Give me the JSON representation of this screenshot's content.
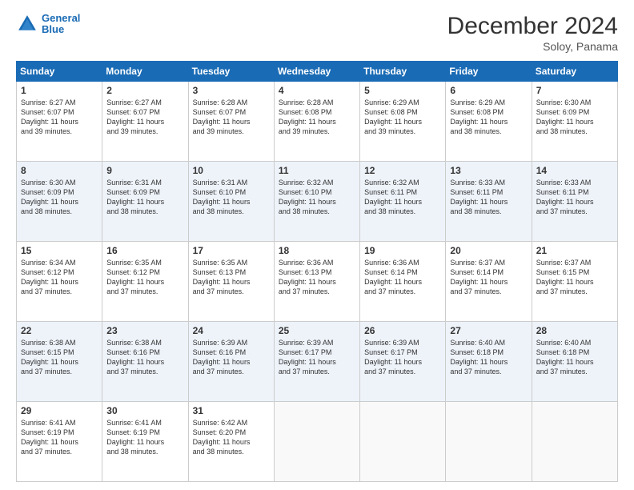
{
  "header": {
    "logo_line1": "General",
    "logo_line2": "Blue",
    "month_title": "December 2024",
    "location": "Soloy, Panama"
  },
  "weekdays": [
    "Sunday",
    "Monday",
    "Tuesday",
    "Wednesday",
    "Thursday",
    "Friday",
    "Saturday"
  ],
  "weeks": [
    [
      {
        "day": "1",
        "info": "Sunrise: 6:27 AM\nSunset: 6:07 PM\nDaylight: 11 hours\nand 39 minutes."
      },
      {
        "day": "2",
        "info": "Sunrise: 6:27 AM\nSunset: 6:07 PM\nDaylight: 11 hours\nand 39 minutes."
      },
      {
        "day": "3",
        "info": "Sunrise: 6:28 AM\nSunset: 6:07 PM\nDaylight: 11 hours\nand 39 minutes."
      },
      {
        "day": "4",
        "info": "Sunrise: 6:28 AM\nSunset: 6:08 PM\nDaylight: 11 hours\nand 39 minutes."
      },
      {
        "day": "5",
        "info": "Sunrise: 6:29 AM\nSunset: 6:08 PM\nDaylight: 11 hours\nand 39 minutes."
      },
      {
        "day": "6",
        "info": "Sunrise: 6:29 AM\nSunset: 6:08 PM\nDaylight: 11 hours\nand 38 minutes."
      },
      {
        "day": "7",
        "info": "Sunrise: 6:30 AM\nSunset: 6:09 PM\nDaylight: 11 hours\nand 38 minutes."
      }
    ],
    [
      {
        "day": "8",
        "info": "Sunrise: 6:30 AM\nSunset: 6:09 PM\nDaylight: 11 hours\nand 38 minutes."
      },
      {
        "day": "9",
        "info": "Sunrise: 6:31 AM\nSunset: 6:09 PM\nDaylight: 11 hours\nand 38 minutes."
      },
      {
        "day": "10",
        "info": "Sunrise: 6:31 AM\nSunset: 6:10 PM\nDaylight: 11 hours\nand 38 minutes."
      },
      {
        "day": "11",
        "info": "Sunrise: 6:32 AM\nSunset: 6:10 PM\nDaylight: 11 hours\nand 38 minutes."
      },
      {
        "day": "12",
        "info": "Sunrise: 6:32 AM\nSunset: 6:11 PM\nDaylight: 11 hours\nand 38 minutes."
      },
      {
        "day": "13",
        "info": "Sunrise: 6:33 AM\nSunset: 6:11 PM\nDaylight: 11 hours\nand 38 minutes."
      },
      {
        "day": "14",
        "info": "Sunrise: 6:33 AM\nSunset: 6:11 PM\nDaylight: 11 hours\nand 37 minutes."
      }
    ],
    [
      {
        "day": "15",
        "info": "Sunrise: 6:34 AM\nSunset: 6:12 PM\nDaylight: 11 hours\nand 37 minutes."
      },
      {
        "day": "16",
        "info": "Sunrise: 6:35 AM\nSunset: 6:12 PM\nDaylight: 11 hours\nand 37 minutes."
      },
      {
        "day": "17",
        "info": "Sunrise: 6:35 AM\nSunset: 6:13 PM\nDaylight: 11 hours\nand 37 minutes."
      },
      {
        "day": "18",
        "info": "Sunrise: 6:36 AM\nSunset: 6:13 PM\nDaylight: 11 hours\nand 37 minutes."
      },
      {
        "day": "19",
        "info": "Sunrise: 6:36 AM\nSunset: 6:14 PM\nDaylight: 11 hours\nand 37 minutes."
      },
      {
        "day": "20",
        "info": "Sunrise: 6:37 AM\nSunset: 6:14 PM\nDaylight: 11 hours\nand 37 minutes."
      },
      {
        "day": "21",
        "info": "Sunrise: 6:37 AM\nSunset: 6:15 PM\nDaylight: 11 hours\nand 37 minutes."
      }
    ],
    [
      {
        "day": "22",
        "info": "Sunrise: 6:38 AM\nSunset: 6:15 PM\nDaylight: 11 hours\nand 37 minutes."
      },
      {
        "day": "23",
        "info": "Sunrise: 6:38 AM\nSunset: 6:16 PM\nDaylight: 11 hours\nand 37 minutes."
      },
      {
        "day": "24",
        "info": "Sunrise: 6:39 AM\nSunset: 6:16 PM\nDaylight: 11 hours\nand 37 minutes."
      },
      {
        "day": "25",
        "info": "Sunrise: 6:39 AM\nSunset: 6:17 PM\nDaylight: 11 hours\nand 37 minutes."
      },
      {
        "day": "26",
        "info": "Sunrise: 6:39 AM\nSunset: 6:17 PM\nDaylight: 11 hours\nand 37 minutes."
      },
      {
        "day": "27",
        "info": "Sunrise: 6:40 AM\nSunset: 6:18 PM\nDaylight: 11 hours\nand 37 minutes."
      },
      {
        "day": "28",
        "info": "Sunrise: 6:40 AM\nSunset: 6:18 PM\nDaylight: 11 hours\nand 37 minutes."
      }
    ],
    [
      {
        "day": "29",
        "info": "Sunrise: 6:41 AM\nSunset: 6:19 PM\nDaylight: 11 hours\nand 37 minutes."
      },
      {
        "day": "30",
        "info": "Sunrise: 6:41 AM\nSunset: 6:19 PM\nDaylight: 11 hours\nand 38 minutes."
      },
      {
        "day": "31",
        "info": "Sunrise: 6:42 AM\nSunset: 6:20 PM\nDaylight: 11 hours\nand 38 minutes."
      },
      {
        "day": "",
        "info": ""
      },
      {
        "day": "",
        "info": ""
      },
      {
        "day": "",
        "info": ""
      },
      {
        "day": "",
        "info": ""
      }
    ]
  ]
}
